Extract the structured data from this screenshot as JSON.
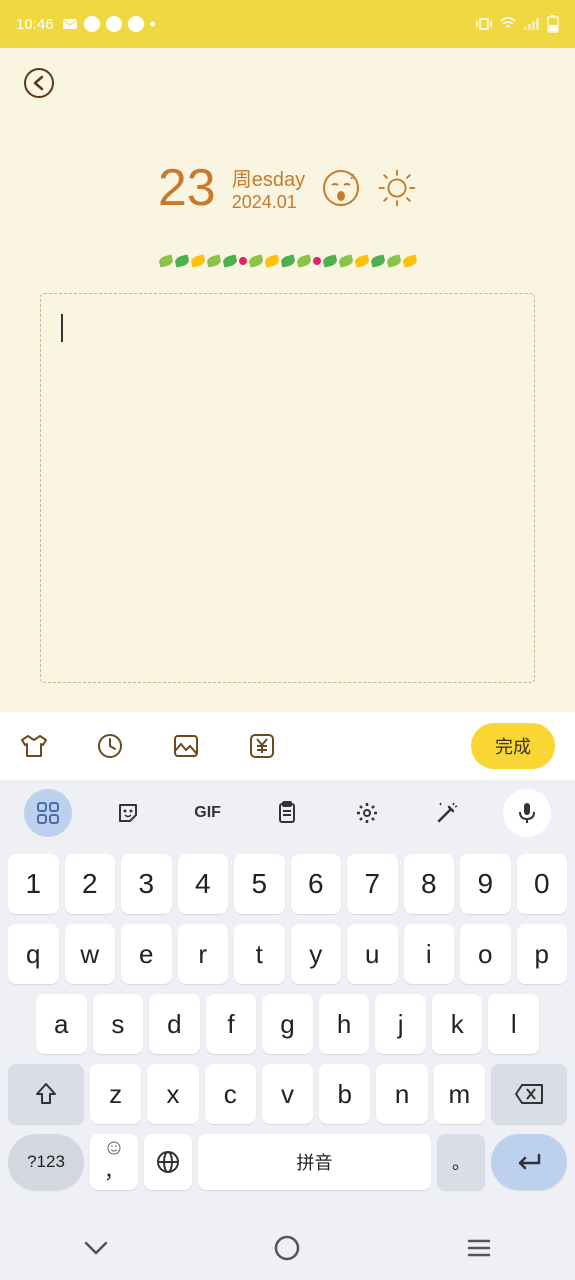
{
  "status": {
    "time": "10:46"
  },
  "date": {
    "day": "23",
    "weekday": "周esday",
    "full": "2024.01"
  },
  "toolbar": {
    "done": "完成"
  },
  "keyboard": {
    "gif": "GIF",
    "row1": [
      "1",
      "2",
      "3",
      "4",
      "5",
      "6",
      "7",
      "8",
      "9",
      "0"
    ],
    "row2": [
      "q",
      "w",
      "e",
      "r",
      "t",
      "y",
      "u",
      "i",
      "o",
      "p"
    ],
    "row3": [
      "a",
      "s",
      "d",
      "f",
      "g",
      "h",
      "j",
      "k",
      "l"
    ],
    "row4": [
      "z",
      "x",
      "c",
      "v",
      "b",
      "n",
      "m"
    ],
    "mode": "?123",
    "comma": "，",
    "space": "拼音",
    "period": "。"
  }
}
